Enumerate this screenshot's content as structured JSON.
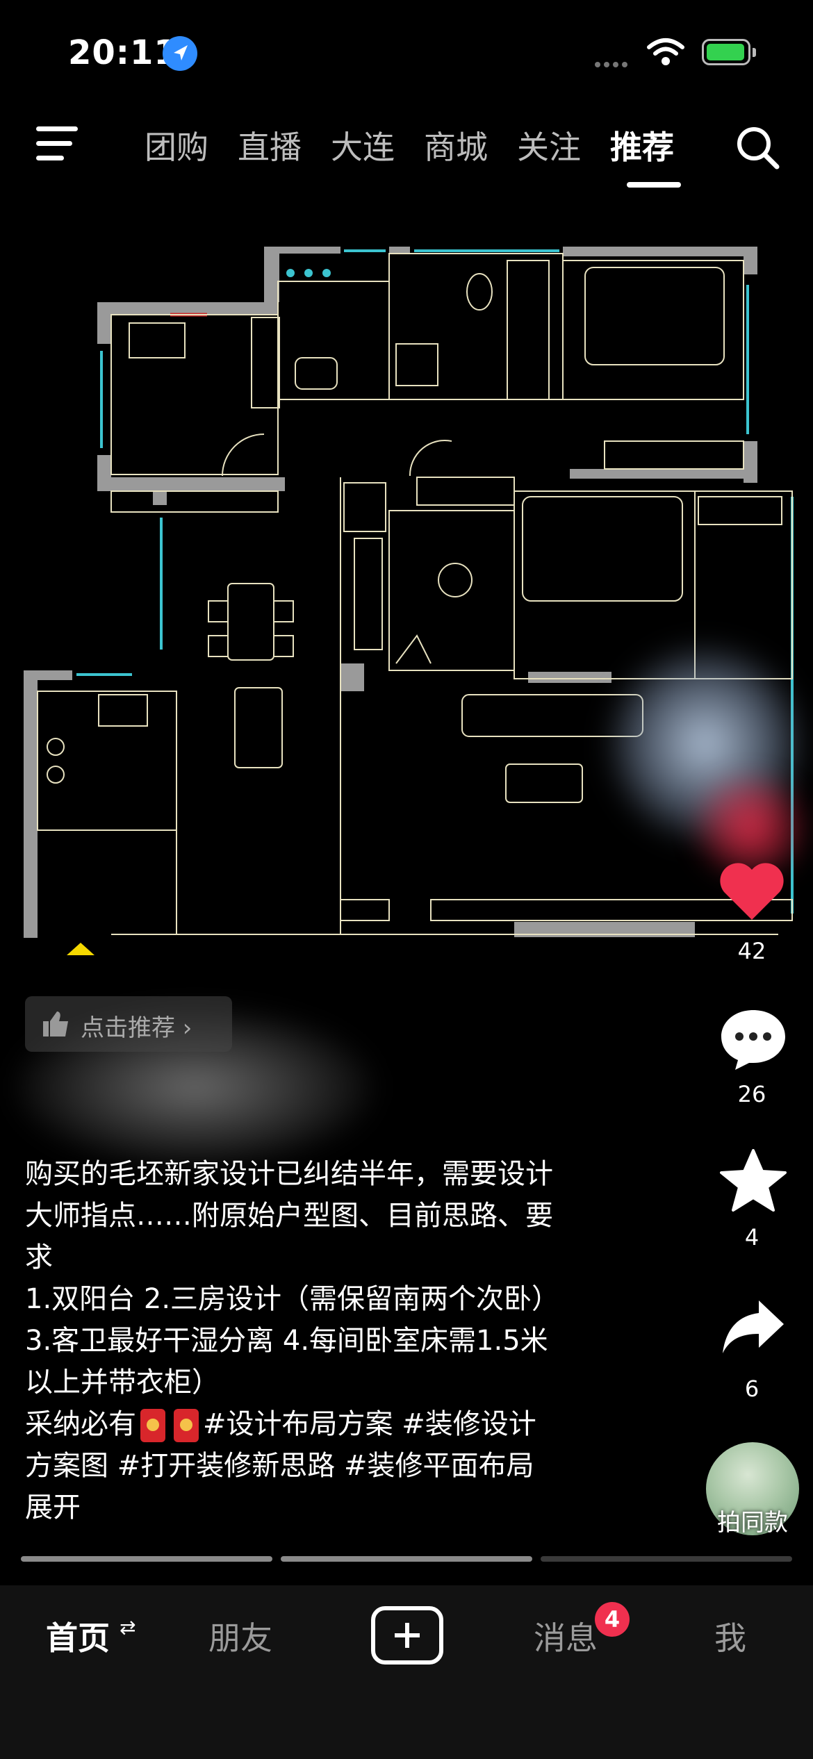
{
  "status_bar": {
    "time": "20:11"
  },
  "top_tabs": [
    {
      "label": "团购"
    },
    {
      "label": "直播"
    },
    {
      "label": "大连"
    },
    {
      "label": "商城"
    },
    {
      "label": "关注"
    },
    {
      "label": "推荐",
      "active": true
    }
  ],
  "rail": {
    "likes": "42",
    "comments": "26",
    "favorites": "4",
    "shares": "6",
    "same_style_label": "拍同款"
  },
  "recommend_chip": "点击推荐 ›",
  "caption": {
    "text_1": "购买的毛坯新家设计已纠结半年，需要设计\n大师指点……附原始户型图、目前思路、要\n求\n1.双阳台 2.三房设计（需保留南两个次卧）\n3.客卫最好干湿分离 4.每间卧室床需1.5米\n以上并带衣柜）\n采纳必有",
    "text_2": "#设计布局方案 #装修设计\n方案图 #打开装修新思路 #装修平面布局\n展开"
  },
  "bottom_nav": {
    "home": "首页",
    "friends": "朋友",
    "messages": "消息",
    "messages_badge": "4",
    "me": "我"
  },
  "colors": {
    "accent_red": "#f0304f",
    "wall": "#9a9a9a",
    "window": "#3cc4d0",
    "line": "#e8e2c0"
  }
}
